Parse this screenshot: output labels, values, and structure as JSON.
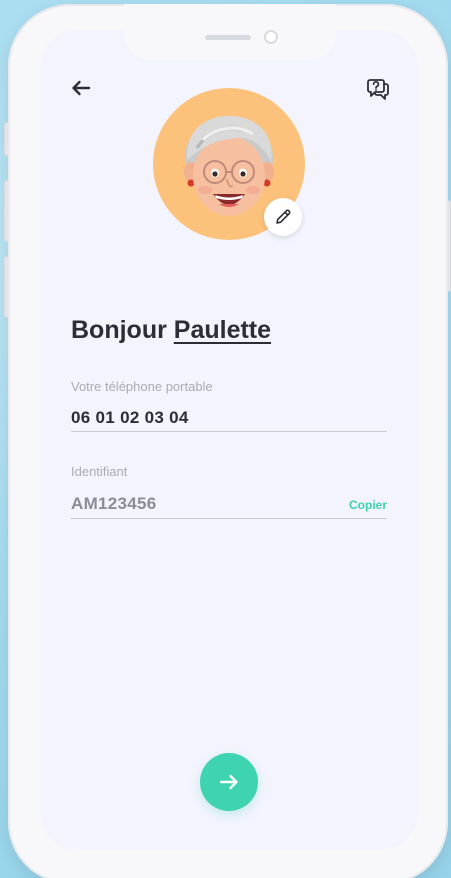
{
  "screen": {
    "greeting_prefix": "Bonjour",
    "user_name": "Paulette",
    "phone": {
      "label": "Votre téléphone portable",
      "value": "06 01 02 03 04"
    },
    "identifier": {
      "label": "Identifiant",
      "value": "AM123456",
      "copy_label": "Copier"
    }
  },
  "icons": {
    "back": "arrow-left-icon",
    "help": "question-chat-icon",
    "edit": "pencil-icon",
    "next": "arrow-right-icon",
    "avatar": "memoji-avatar"
  },
  "colors": {
    "accent": "#3ed3b1",
    "avatar_bg": "#fcc27c",
    "screen_bg": "#f3f4fd",
    "text_dark": "#2d2d35",
    "label_grey": "#a9abb7"
  }
}
